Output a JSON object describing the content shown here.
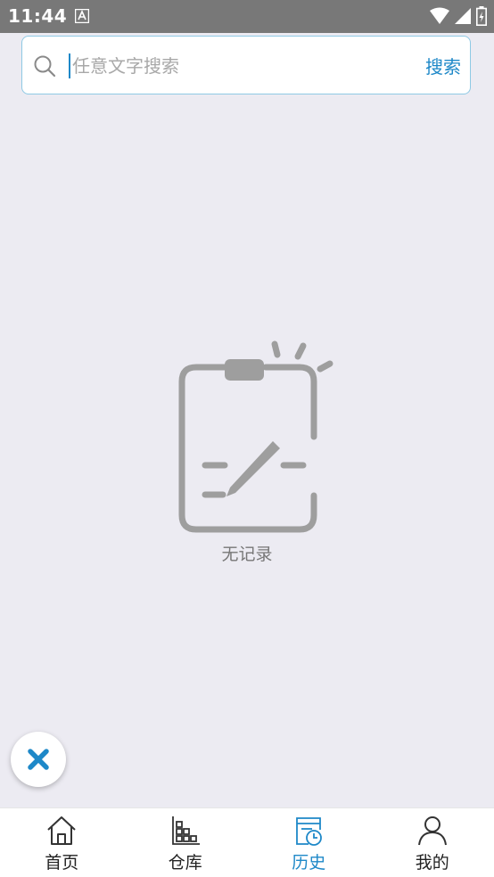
{
  "status_bar": {
    "time": "11:44",
    "icons": [
      "notification-a-icon",
      "wifi-icon",
      "cell-signal-icon",
      "battery-icon"
    ]
  },
  "search": {
    "placeholder": "任意文字搜索",
    "value": "",
    "button_label": "搜索"
  },
  "empty_state": {
    "icon": "empty-clipboard-icon",
    "message": "无记录"
  },
  "fab": {
    "icon": "close-icon"
  },
  "bottom_nav": {
    "items": [
      {
        "label": "首页",
        "icon": "home-icon",
        "active": false
      },
      {
        "label": "仓库",
        "icon": "warehouse-icon",
        "active": false
      },
      {
        "label": "历史",
        "icon": "history-icon",
        "active": true
      },
      {
        "label": "我的",
        "icon": "user-icon",
        "active": false
      }
    ]
  },
  "colors": {
    "accent": "#1e88c8",
    "background": "#ecebf2",
    "status_bar": "#787878",
    "illustration": "#9e9e9e"
  }
}
